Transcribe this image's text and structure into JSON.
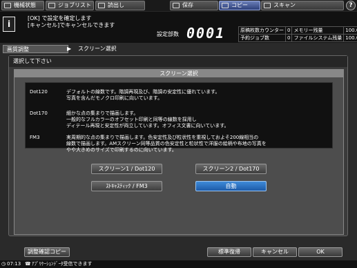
{
  "tabs": [
    {
      "label": "機械状態",
      "active": false
    },
    {
      "label": "ジョブリスト",
      "active": false
    },
    {
      "label": "読出し",
      "active": false
    },
    {
      "label": "保存",
      "active": false
    },
    {
      "label": "コピー",
      "active": true
    },
    {
      "label": "スキャン",
      "active": false
    }
  ],
  "help_label": "?",
  "info": {
    "icon": "i",
    "line1": "[OK] で設定を確定します",
    "line2": "[キャンセル]でキャンセルできます",
    "copies_label": "設定部数",
    "copies_value": "0001"
  },
  "status": {
    "row1": {
      "label1": "原稿枚数カウンター",
      "value1": "0",
      "label2": "メモリー残量",
      "value2": "100.000%"
    },
    "row2": {
      "label1": "予約ジョブ数",
      "value1": "0",
      "label2": "ファイルシステム残量",
      "value2": "100.000%"
    }
  },
  "breadcrumb": {
    "item1": "画質調整",
    "arrow": "▶",
    "item2": "スクリーン選択"
  },
  "prompt": "選択して下さい",
  "dialog_title": "スクリーン選択",
  "descriptions": [
    {
      "name": "Dot120",
      "text": "デフォルトの線数です。階調再現及び、階調の安定性に優れています。\n写真を含んだモノクロ印刷に向いています。"
    },
    {
      "name": "Dot170",
      "text": "細かな点の集まりで描画します。\n一般的なフルカラーのオフセット印刷と同等の線数を採用し\nディテール再現と安定性が両立しています。オフィス文書に向いています。"
    },
    {
      "name": "FM3",
      "text": "実周期的な点の集まりで描画します。色安定性及び粒状性を重視しておよそ200線相当の\n線数で描画します。AMスクリーン同等品質の色安定性と粒状性で洋服の絵柄や布地の写真を\nやや大きめのサイズで印刷するのに向いています。"
    }
  ],
  "buttons": {
    "screen1": "スクリーン1 / Dot120",
    "screen2": "スクリーン2 / Dot170",
    "stochastic": "ｽﾄｷｬｽﾃｨｯｸ / FM3",
    "auto": "自動"
  },
  "bottom": {
    "adjust_copy": "調整確認コピー",
    "reset": "標準復帰",
    "cancel": "キャンセル",
    "ok": "OK"
  },
  "statusline": {
    "time": "07:13",
    "message": "ｱﾌﾟﾘｹｰｼｮﾝﾃﾞｰﾀ受信できます"
  }
}
